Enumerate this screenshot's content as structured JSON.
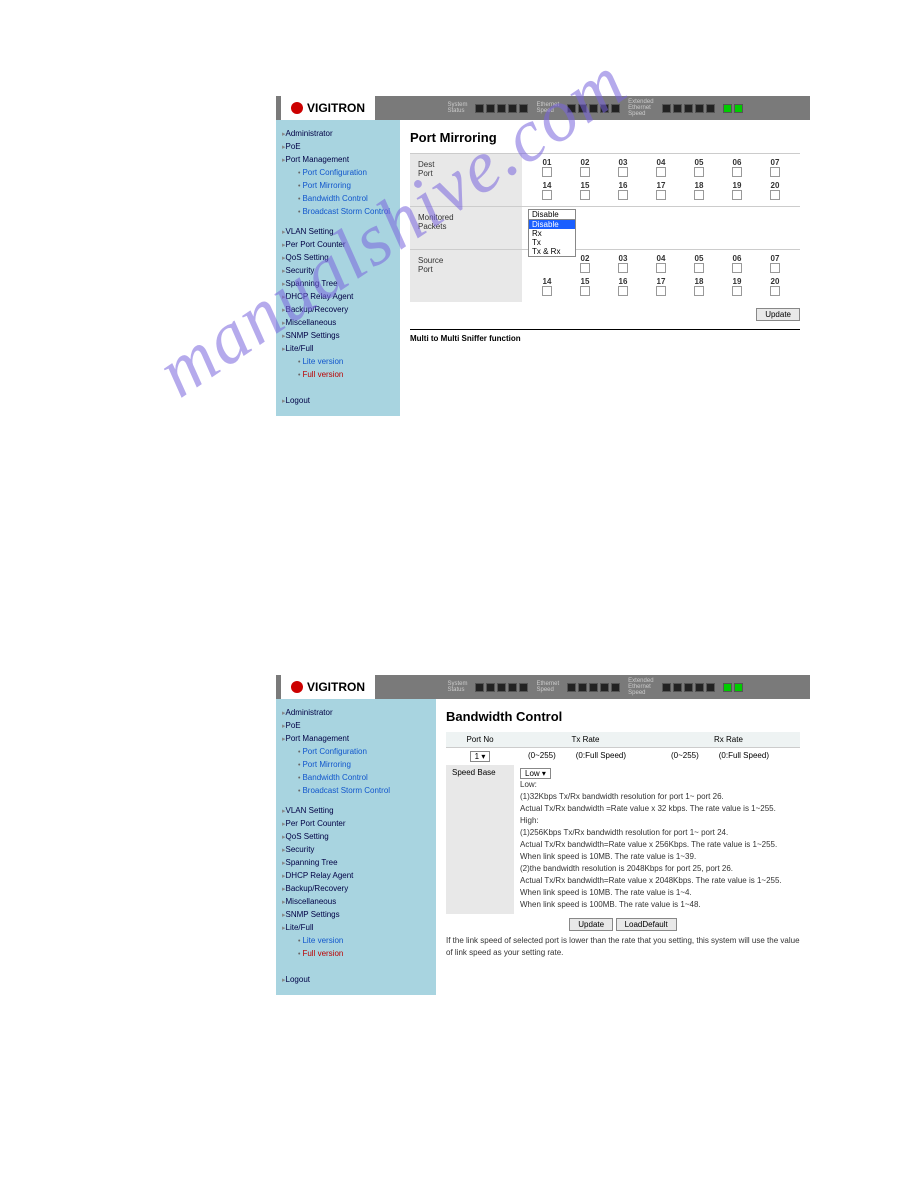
{
  "brand": "VIGITRON",
  "watermark": "manualshive.com",
  "nav": {
    "top": [
      "Administrator",
      "PoE",
      "Port Management"
    ],
    "pm_sub": [
      "Port Configuration",
      "Port Mirroring",
      "Bandwidth Control",
      "Broadcast Storm Control"
    ],
    "rest": [
      "VLAN Setting",
      "Per Port Counter",
      "QoS Setting",
      "Security",
      "Spanning Tree",
      "DHCP Relay Agent",
      "Backup/Recovery",
      "Miscellaneous",
      "SNMP Settings",
      "Lite/Full"
    ],
    "versions": [
      "Lite version",
      "Full version"
    ],
    "logout": "Logout"
  },
  "mirror": {
    "title": "Port Mirroring",
    "dest_label": "Dest\nPort",
    "mon_label": "Monitored\nPackets",
    "src_label": "Source\nPort",
    "cols_top": [
      "01",
      "02",
      "03",
      "04",
      "05",
      "06",
      "07"
    ],
    "cols_bot": [
      "14",
      "15",
      "16",
      "17",
      "18",
      "19",
      "20"
    ],
    "dropdown": {
      "selected": "Disable",
      "options": [
        "Disable",
        "Rx",
        "Tx",
        "Tx & Rx"
      ]
    },
    "update": "Update",
    "footer": "Multi to Multi Sniffer function"
  },
  "bw": {
    "title": "Bandwidth Control",
    "hdr": {
      "portno": "Port No",
      "tx": "Tx Rate",
      "rx": "Rx Rate"
    },
    "range": "(0~255)",
    "full": "(0:Full Speed)",
    "port_sel": "1",
    "speed_label": "Speed Base",
    "speed_sel": "Low",
    "desc_lines": [
      "Low:",
      "(1)32Kbps Tx/Rx bandwidth resolution for port 1~ port 26.",
      "    Actual Tx/Rx bandwidth =Rate value x 32 kbps. The rate value is 1~255.",
      "High:",
      "(1)256Kbps Tx/Rx bandwidth resolution for port 1~ port 24.",
      "    Actual Tx/Rx bandwidth=Rate value x 256Kbps. The rate value is 1~255.",
      "    When link speed is 10MB. The rate value is 1~39.",
      "(2)the bandwidth resolution is 2048Kbps for port 25, port 26.",
      "    Actual Tx/Rx bandwidth=Rate value x 2048Kbps. The rate value is 1~255.",
      "    When link speed is 10MB. The rate value is 1~4.",
      "    When link speed is 100MB. The rate value is 1~48."
    ],
    "update": "Update",
    "loaddef": "LoadDefault",
    "note": "If the link speed of selected port is lower than the rate that you setting, this system will use the value of link speed as your setting rate."
  }
}
